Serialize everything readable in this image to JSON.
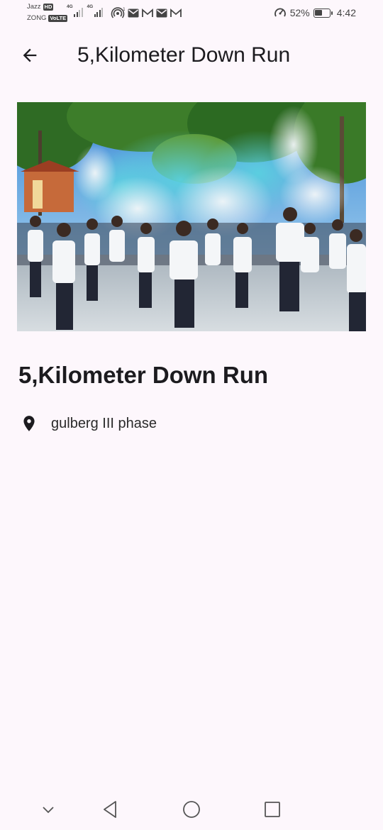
{
  "status_bar": {
    "carrier_1": "Jazz",
    "carrier_1_tag": "HD",
    "carrier_2": "ZONG",
    "carrier_2_tag": "VoLTE",
    "network_1": "4G",
    "network_2": "4G",
    "battery_level": 0.52,
    "battery_percent": "52%",
    "time": "4:42",
    "icons": [
      "signal-icon",
      "signal-icon",
      "hotspot-icon",
      "mail-icon",
      "gmail-icon",
      "mail-icon",
      "gmail-icon",
      "data-saver-icon",
      "battery-icon"
    ]
  },
  "app_bar": {
    "back_icon": "arrow-back-icon",
    "title": "5,Kilometer Down Run"
  },
  "event": {
    "image_description_icon": "event-photo",
    "title": "5,Kilometer Down Run",
    "location_icon": "location-pin-icon",
    "location": "gulberg III phase"
  },
  "nav_bar": {
    "icons": [
      "chevron-down-icon",
      "back-triangle-icon",
      "home-circle-icon",
      "recents-square-icon"
    ]
  },
  "colors": {
    "background": "#fdf7fc",
    "text": "#1c1b1f",
    "icon": "#444444"
  }
}
